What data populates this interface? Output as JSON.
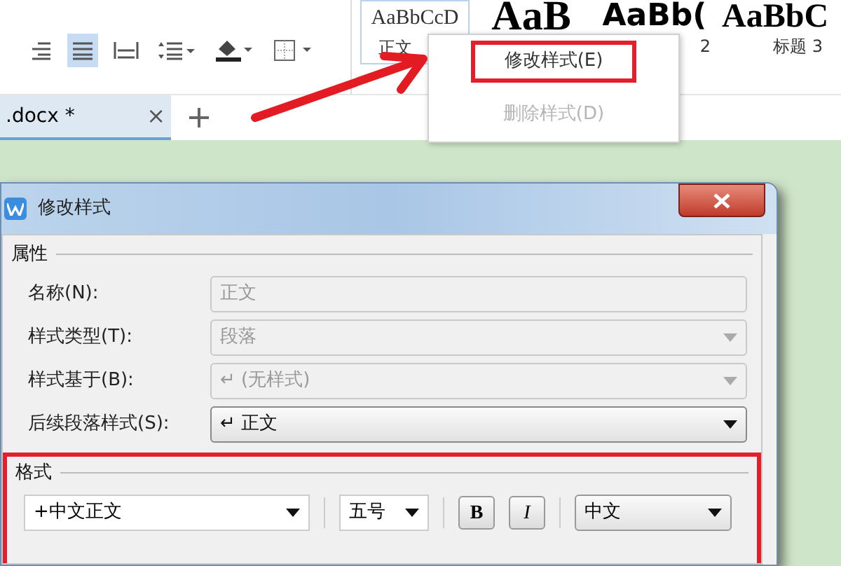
{
  "ribbon": {
    "tools": [
      {
        "kind": "align-right",
        "selected": false
      },
      {
        "kind": "justify",
        "selected": true
      },
      {
        "kind": "distribute",
        "selected": false
      },
      {
        "kind": "line-spacing",
        "selected": false
      },
      {
        "kind": "shading",
        "selected": false
      },
      {
        "kind": "borders",
        "selected": false
      }
    ],
    "styles": [
      {
        "preview": "AaBbCcD",
        "label": "正文",
        "kind": "normal"
      },
      {
        "preview": "AaB",
        "kind": "h1"
      },
      {
        "preview": "AaBb(",
        "label": "2",
        "kind": "h2"
      },
      {
        "preview": "AaBbC",
        "label": "标题 3",
        "kind": "h3"
      }
    ]
  },
  "context_menu": {
    "items": [
      {
        "label": "修改样式(E)",
        "disabled": false,
        "highlighted": true
      },
      {
        "label": "删除样式(D)",
        "disabled": true,
        "highlighted": false
      }
    ]
  },
  "document_tab": {
    "label": ".docx *",
    "close": "×",
    "selected": true
  },
  "dialog": {
    "title": "修改样式",
    "properties": {
      "heading": "属性",
      "rows": [
        {
          "label": "名称(N):",
          "value": "正文",
          "kind": "text",
          "disabled": true
        },
        {
          "label": "样式类型(T):",
          "value": "段落",
          "kind": "select",
          "disabled": true
        },
        {
          "label": "样式基于(B):",
          "value": "↵ (无样式)",
          "kind": "select",
          "disabled": true
        },
        {
          "label": "后续段落样式(S):",
          "value": "↵ 正文",
          "kind": "select",
          "disabled": false
        }
      ]
    },
    "format": {
      "heading": "格式",
      "highlighted": true,
      "font": "+中文正文",
      "size": "五号",
      "bold": {
        "label": "B",
        "on": false
      },
      "italic": {
        "label": "I",
        "on": false
      },
      "script": "中文"
    }
  }
}
